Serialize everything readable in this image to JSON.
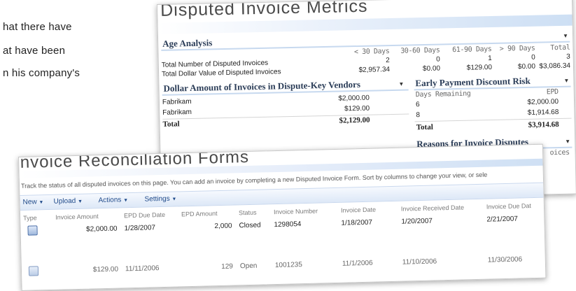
{
  "body_text": [
    "hat there have",
    "at  have  been",
    "n his company's"
  ],
  "metrics": {
    "title": "Disputed Invoice Metrics",
    "age_analysis": {
      "header": "Age Analysis",
      "columns": [
        "< 30 Days",
        "30-60 Days",
        "61-90 Days",
        "> 90 Days",
        "Total"
      ],
      "rows": [
        {
          "label": "Total Number of Disputed Invoices",
          "values": [
            "2",
            "0",
            "1",
            "0",
            "3"
          ]
        },
        {
          "label": "Total Dollar Value of Disputed Invoices",
          "values": [
            "$2,957.34",
            "$0.00",
            "$129.00",
            "$0.00",
            "$3,086.34"
          ]
        }
      ]
    },
    "dollar_amount": {
      "header": "Dollar Amount of Invoices in Dispute-Key Vendors",
      "rows": [
        {
          "vendor": "Fabrikam",
          "amount": "$2,000.00"
        },
        {
          "vendor": "Fabrikam",
          "amount": "$129.00"
        }
      ],
      "total_label": "Total",
      "total_value": "$2,129.00"
    },
    "early_payment": {
      "header": "Early Payment Discount Risk",
      "columns": [
        "Days Remaining",
        "EPD"
      ],
      "rows": [
        {
          "days": "6",
          "epd": "$2,000.00"
        },
        {
          "days": "8",
          "epd": "$1,914.68"
        }
      ],
      "total_label": "Total",
      "total_value": "$3,914.68"
    },
    "reasons": {
      "header": "Reasons for Invoice Disputes",
      "partial_col": "oices"
    }
  },
  "recon": {
    "title": "Invoice Reconciliation Forms",
    "description": "Track the status of all disputed invoices on this page.  You can add an invoice by completing a new Disputed Invoice Form.  Sort by columns to change your view, or sele",
    "toolbar": [
      "New",
      "Upload",
      "Actions",
      "Settings"
    ],
    "columns": [
      "Type",
      "Invoice Amount",
      "EPD Due Date",
      "EPD Amount",
      "Status",
      "Invoice Number",
      "Invoice Date",
      "Invoice Received Date",
      "Invoice Due Dat"
    ],
    "rows": [
      [
        "",
        "$2,000.00",
        "1/28/2007",
        "2,000",
        "Closed",
        "1298054",
        "1/18/2007",
        "1/20/2007",
        "2/21/2007"
      ],
      [
        "",
        "$129.00",
        "11/11/2006",
        "129",
        "Open",
        "1001235",
        "11/1/2006",
        "11/10/2006",
        "11/30/2006"
      ]
    ]
  },
  "icons": {
    "dropdown": "chevron-down-icon",
    "document": "document-icon"
  },
  "colors": {
    "header_text": "#2b3d58",
    "toolbar_link": "#1f4a8a",
    "band": "#cddff4"
  }
}
